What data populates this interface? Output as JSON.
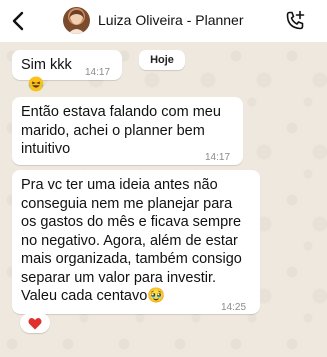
{
  "header": {
    "contact_name": "Luiza Oliveira - Planner",
    "back_icon": "chevron-left-icon",
    "call_icon": "phone-add-icon"
  },
  "chat": {
    "date_chip": "Hoje",
    "messages": [
      {
        "text": "Sim kkk",
        "time": "14:17"
      },
      {
        "text": "Então estava falando com meu marido, achei o planner bem intuitivo",
        "time": "14:17"
      },
      {
        "text": "Pra vc ter uma ideia antes não conseguia nem me planejar para os gastos do mês e ficava sempre no negativo. Agora, além de estar mais organizada, também consigo separar um valor para investir. Valeu cada centavo🥹",
        "time": "14:25"
      }
    ]
  },
  "colors": {
    "chat_background": "#efe8de",
    "bubble": "#ffffff",
    "reaction_heart": "#e0302d"
  }
}
